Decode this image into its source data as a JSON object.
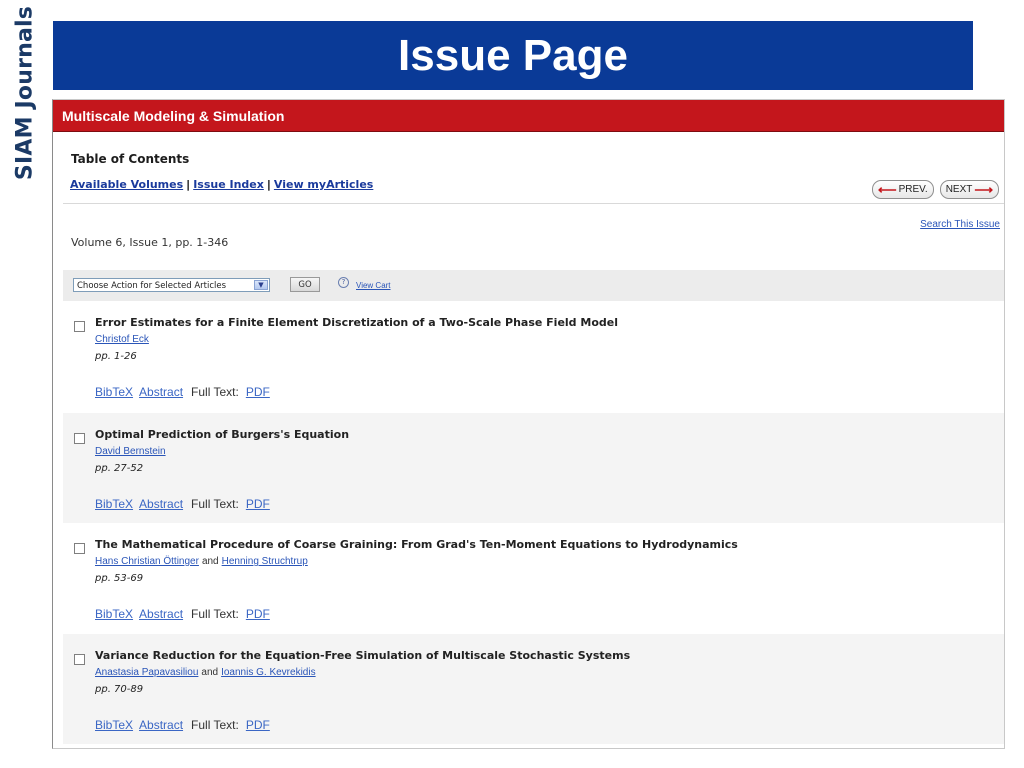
{
  "side_title": "SIAM Journals",
  "banner_title": "Issue Page",
  "journal_name": "Multiscale Modeling & Simulation",
  "toc_title": "Table of Contents",
  "nav": {
    "available_volumes": "Available Volumes",
    "issue_index": "Issue Index",
    "view_myarticles": "View myArticles",
    "separator": "|"
  },
  "pager": {
    "prev": "PREV.",
    "next": "NEXT",
    "prev_arrow": "⟵",
    "next_arrow": "⟶"
  },
  "search_issue": "Search This Issue",
  "volume_info": "Volume 6, Issue 1, pp. 1-346",
  "actions": {
    "select_value": "Choose Action for Selected Articles",
    "dropdown_glyph": "▼",
    "go": "GO",
    "help_glyph": "?",
    "view_cart": "View Cart"
  },
  "colors": {
    "banner": "#0a3a97",
    "journal_bar": "#c4161c",
    "link": "#2a55b8"
  },
  "article_links": {
    "bibtex": "BibTeX",
    "abstract": "Abstract",
    "full_text": "Full Text:",
    "pdf": "PDF"
  },
  "articles": [
    {
      "title": "Error Estimates for a Finite Element Discretization of a Two-Scale Phase Field Model",
      "authors": [
        "Christof Eck"
      ],
      "joiner": "",
      "pages": "pp. 1-26"
    },
    {
      "title": "Optimal Prediction of Burgers's Equation",
      "authors": [
        "David Bernstein"
      ],
      "joiner": "",
      "pages": "pp. 27-52"
    },
    {
      "title": "The Mathematical Procedure of Coarse Graining: From Grad's Ten-Moment Equations to Hydrodynamics",
      "authors": [
        "Hans Christian Öttinger",
        "Henning Struchtrup"
      ],
      "joiner": "and",
      "pages": "pp. 53-69"
    },
    {
      "title": "Variance Reduction for the Equation-Free Simulation of Multiscale Stochastic Systems",
      "authors": [
        "Anastasia Papavasiliou",
        "Ioannis G. Kevrekidis"
      ],
      "joiner": "and",
      "pages": "pp. 70-89"
    }
  ]
}
